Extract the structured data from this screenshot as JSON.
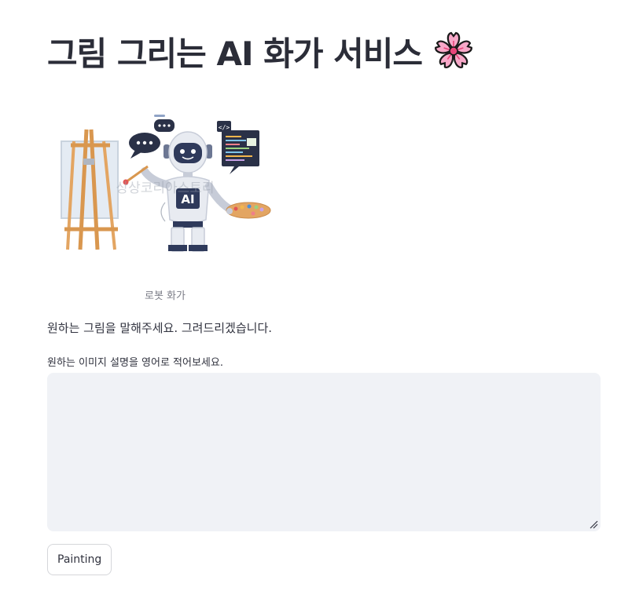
{
  "header": {
    "title": "그림 그리는 AI 화가 서비스",
    "title_icon": "cherry-blossom-icon"
  },
  "illustration": {
    "caption": "로봇 화가",
    "badge_text": "AI",
    "code_icon_text": "</>",
    "watermark": "상상코리아스토리"
  },
  "main": {
    "instruction": "원하는 그림을 말해주세요. 그려드리겠습니다.",
    "field_label": "원하는 이미지 설명을 영어로 적어보세요.",
    "field_value": "",
    "button_label": "Painting"
  },
  "colors": {
    "textarea_bg": "#f0f2f6",
    "button_border": "#d5d6da",
    "text": "#31333f"
  }
}
